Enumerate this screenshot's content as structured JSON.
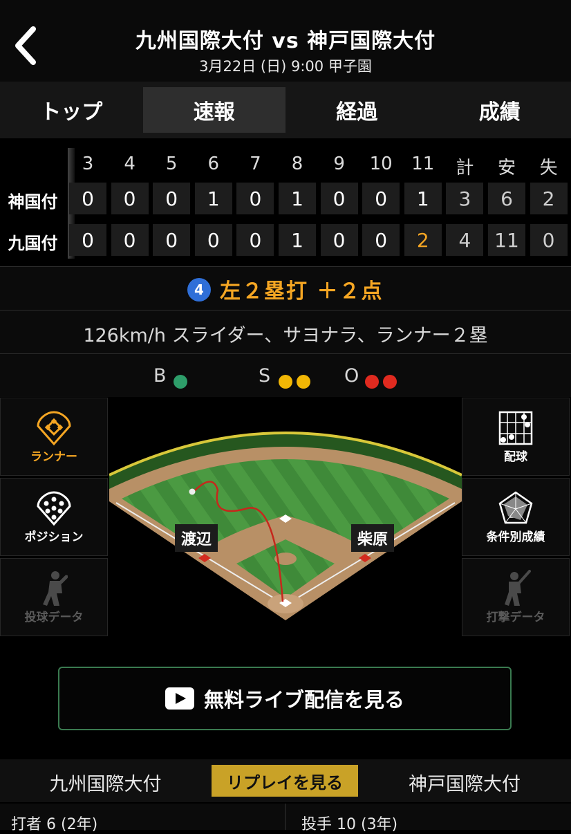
{
  "header": {
    "back_icon": "chevron-left-icon",
    "title": "九州国際大付 vs 神戸国際大付",
    "subtitle": "3月22日 (日) 9:00 甲子園"
  },
  "tabs": [
    {
      "label": "トップ",
      "active": false
    },
    {
      "label": "速報",
      "active": true
    },
    {
      "label": "経過",
      "active": false
    },
    {
      "label": "成績",
      "active": false
    }
  ],
  "scoreboard": {
    "innings": [
      "3",
      "4",
      "5",
      "6",
      "7",
      "8",
      "9",
      "10",
      "11"
    ],
    "totals_headers": [
      "計",
      "安",
      "失"
    ],
    "rows": [
      {
        "team": "神国付",
        "scores": [
          "0",
          "0",
          "0",
          "1",
          "0",
          "1",
          "0",
          "0",
          "1"
        ],
        "totals": [
          "3",
          "6",
          "2"
        ]
      },
      {
        "team": "九国付",
        "scores": [
          "0",
          "0",
          "0",
          "0",
          "0",
          "1",
          "0",
          "0",
          "2"
        ],
        "totals": [
          "4",
          "11",
          "0"
        ]
      }
    ],
    "highlight_color": "#f5a623"
  },
  "play": {
    "batter_number": "4",
    "result": "左２塁打 ＋２点",
    "description": "126km/h スライダー、サヨナラ、ランナー２塁"
  },
  "count": {
    "ball_label": "B",
    "balls": 1,
    "strike_label": "S",
    "strikes": 2,
    "out_label": "O",
    "outs": 2,
    "colors": {
      "ball": "#2e9e6a",
      "strike": "#f2b705",
      "out": "#e02a1f"
    }
  },
  "side_buttons": {
    "runner": "ランナー",
    "position": "ポジション",
    "pitch_data": "投球データ",
    "pitch_chart": "配球",
    "conditional_stats": "条件別成績",
    "batting_data": "打撃データ"
  },
  "field": {
    "fielder_left": "渡辺",
    "fielder_right": "柴原"
  },
  "live_button": {
    "label": "無料ライブ配信を見る",
    "icon": "play-icon"
  },
  "bottom": {
    "home_team": "九州国際大付",
    "replay": "リプレイを見る",
    "away_team": "神戸国際大付",
    "batter": "打者 6 (2年)",
    "pitcher": "投手 10 (3年)"
  }
}
